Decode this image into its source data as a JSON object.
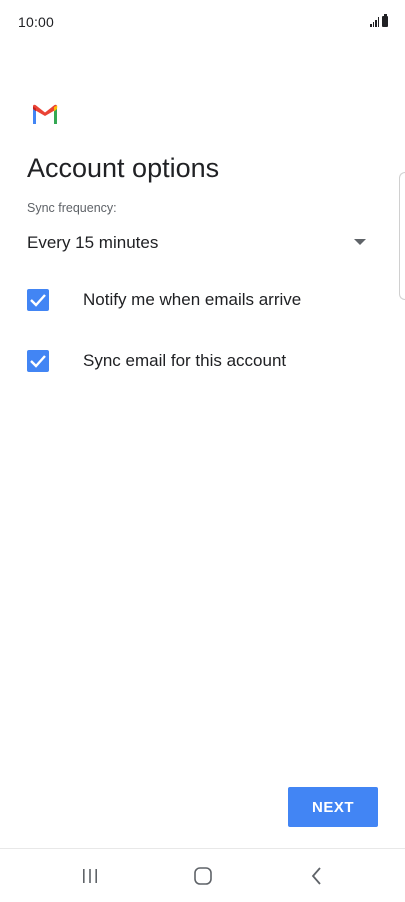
{
  "status_bar": {
    "time": "10:00",
    "icons": [
      "signal-icon",
      "battery-icon"
    ]
  },
  "app": {
    "logo": "gmail-logo",
    "colors": {
      "red": "#ea4335",
      "blue": "#4285f4",
      "green": "#34a853",
      "yellow": "#fbbc04"
    }
  },
  "page": {
    "title": "Account options",
    "sync_label": "Sync frequency:",
    "sync_value": "Every 15 minutes"
  },
  "options": [
    {
      "label": "Notify me when emails arrive",
      "checked": true
    },
    {
      "label": "Sync email for this account",
      "checked": true
    }
  ],
  "actions": {
    "next_label": "NEXT",
    "accent": "#4285f4"
  },
  "nav_bar": {
    "icons": [
      "recents-icon",
      "home-icon",
      "back-icon"
    ]
  }
}
